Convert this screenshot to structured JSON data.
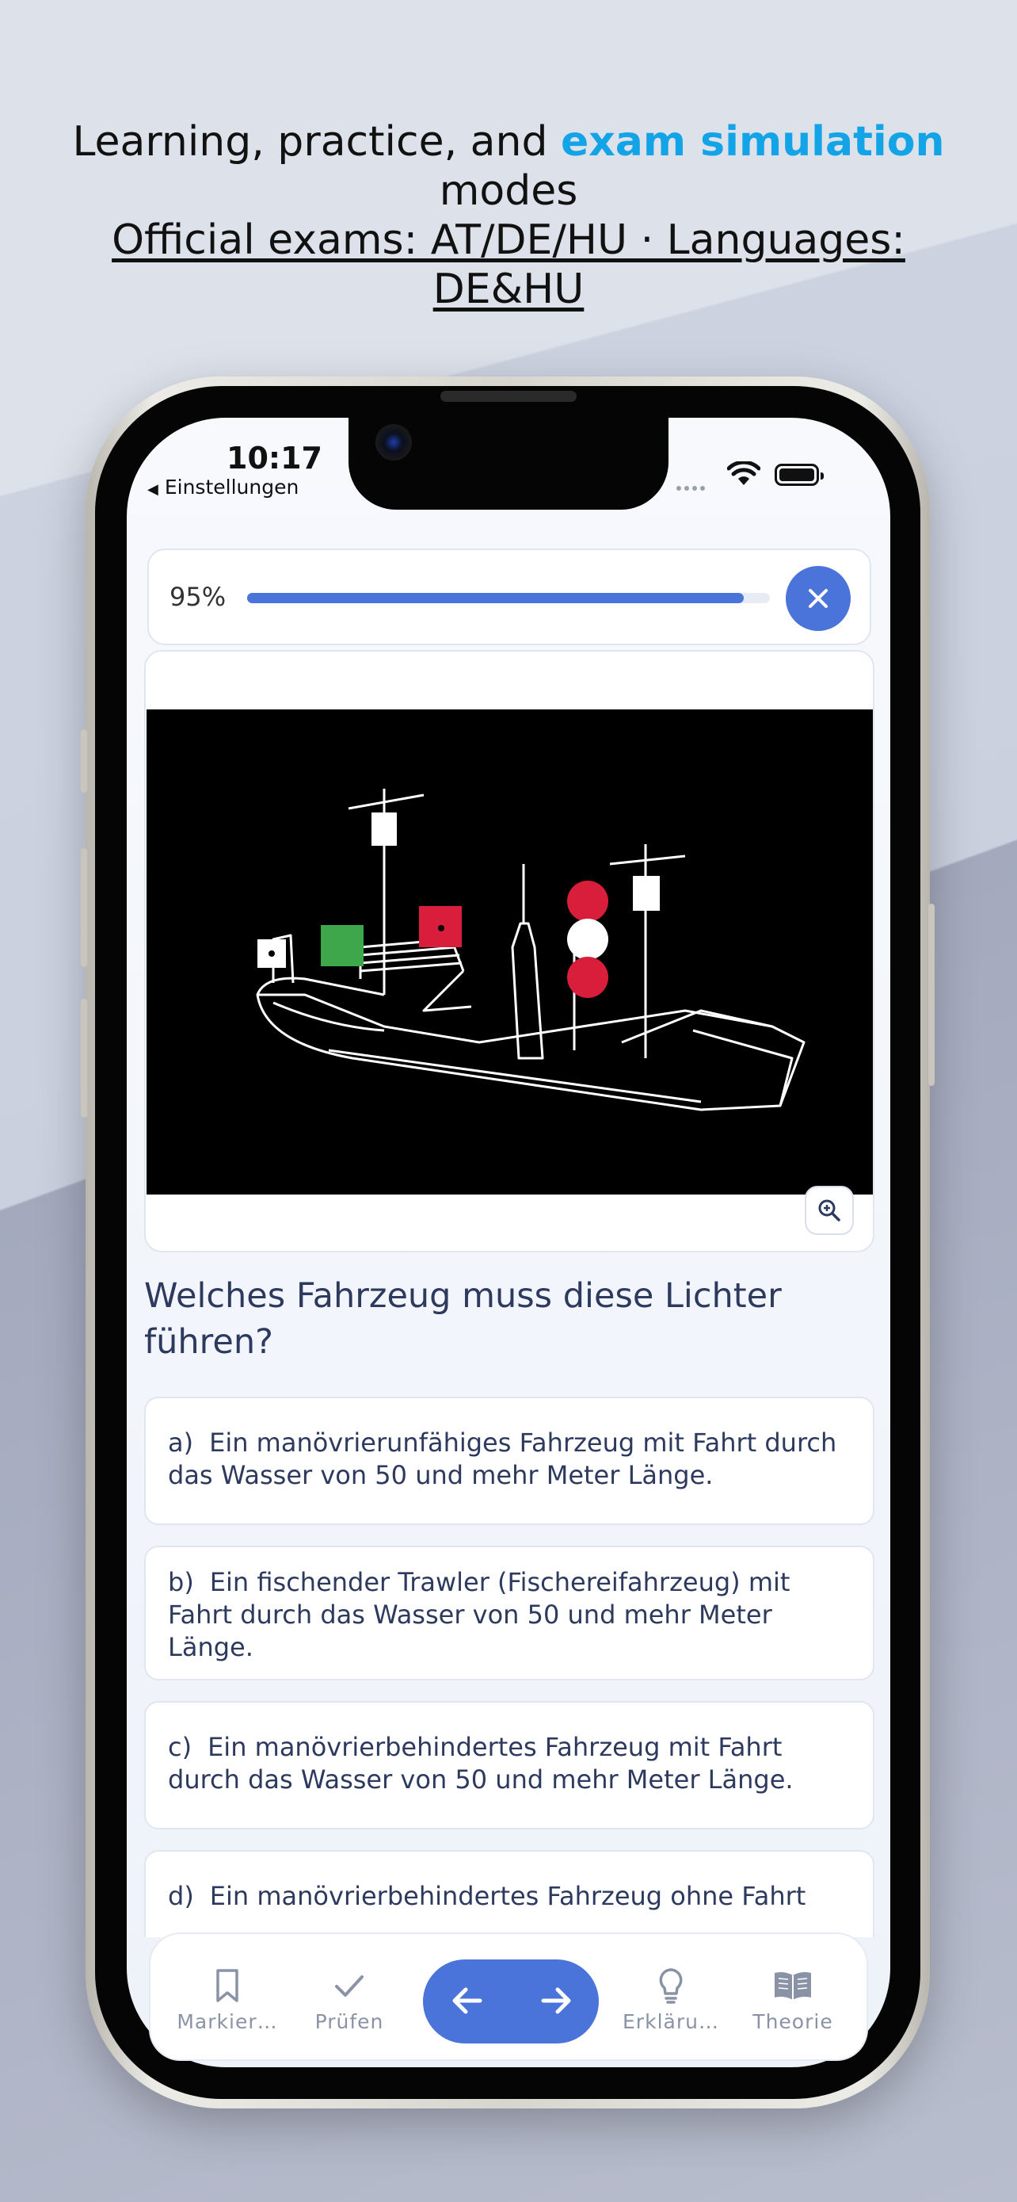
{
  "promo": {
    "line1_a": "Learning, practice, and ",
    "line1_accent": "exam simulation",
    "line1_b": "modes",
    "line2": "Official exams: AT/DE/HU · Languages: DE&HU"
  },
  "status_bar": {
    "time": "10:17",
    "back_label": "Einstellungen"
  },
  "progress": {
    "percent_label": "95%",
    "value": 0.95
  },
  "question": {
    "text": "Welches Fahrzeug muss diese Lichter führen?"
  },
  "answers": [
    {
      "letter": "a)",
      "text": "Ein manövrierunfähiges Fahrzeug mit Fahrt durch das Wasser von 50 und mehr Meter Länge."
    },
    {
      "letter": "b)",
      "text": "Ein fischender Trawler (Fischereifahrzeug) mit Fahrt durch das Wasser von 50 und mehr Meter Länge."
    },
    {
      "letter": "c)",
      "text": "Ein manövrierbehindertes Fahrzeug mit Fahrt durch das Wasser von 50 und mehr Meter Länge."
    },
    {
      "letter": "d)",
      "text": "Ein manövrierbehindertes Fahrzeug ohne Fahrt"
    }
  ],
  "bottom_bar": {
    "mark_label": "Markier…",
    "check_label": "Prüfen",
    "explain_label": "Erkläru…",
    "theory_label": "Theorie"
  },
  "icons": {
    "close": "close-icon",
    "zoom": "zoom-in-icon",
    "mark": "bookmark-icon",
    "check": "checkmark-icon",
    "prev": "arrow-left-icon",
    "next": "arrow-right-icon",
    "explain": "lightbulb-icon",
    "theory": "book-icon"
  },
  "colors": {
    "accent": "#4a74d9",
    "promo_highlight": "#12a4e6",
    "text_primary": "#2d3a5e"
  }
}
